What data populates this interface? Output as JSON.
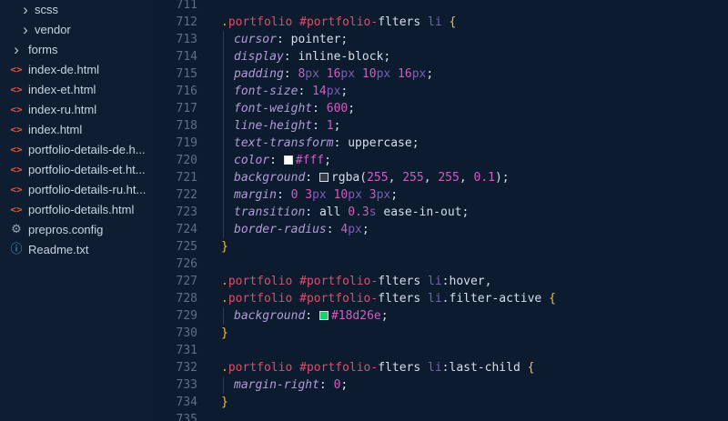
{
  "explorer": {
    "items": [
      {
        "type": "folder",
        "label": "scss",
        "depth": 1
      },
      {
        "type": "folder",
        "label": "vendor",
        "depth": 1
      },
      {
        "type": "folder",
        "label": "forms",
        "depth": 0
      },
      {
        "type": "html",
        "label": "index-de.html",
        "depth": 0
      },
      {
        "type": "html",
        "label": "index-et.html",
        "depth": 0
      },
      {
        "type": "html",
        "label": "index-ru.html",
        "depth": 0
      },
      {
        "type": "html",
        "label": "index.html",
        "depth": 0
      },
      {
        "type": "html",
        "label": "portfolio-details-de.h...",
        "depth": 0
      },
      {
        "type": "html",
        "label": "portfolio-details-et.ht...",
        "depth": 0
      },
      {
        "type": "html",
        "label": "portfolio-details-ru.ht...",
        "depth": 0
      },
      {
        "type": "html",
        "label": "portfolio-details.html",
        "depth": 0
      },
      {
        "type": "config",
        "label": "prepros.config",
        "depth": 0
      },
      {
        "type": "text",
        "label": "Readme.txt",
        "depth": 0
      }
    ],
    "icons": {
      "folder": "chevron-right-icon",
      "html": "html-tag-icon",
      "config": "gear-icon",
      "text": "info-icon"
    }
  },
  "editor": {
    "lines": [
      {
        "n": "711",
        "tokens": []
      },
      {
        "n": "712",
        "tokens": [
          [
            ".",
            "dot"
          ],
          [
            "portfolio",
            "sel"
          ],
          [
            " ",
            "val"
          ],
          [
            "#",
            "hash"
          ],
          [
            "portfolio-",
            "sel"
          ],
          [
            "flters",
            "val"
          ],
          [
            " ",
            "val"
          ],
          [
            "li",
            "tag"
          ],
          [
            " ",
            "val"
          ],
          [
            "{",
            "brace"
          ]
        ]
      },
      {
        "n": "713",
        "indent": true,
        "tokens": [
          [
            "cursor",
            "prop"
          ],
          [
            ": ",
            "colon"
          ],
          [
            "pointer",
            "val"
          ],
          [
            ";",
            "semi"
          ]
        ]
      },
      {
        "n": "714",
        "indent": true,
        "tokens": [
          [
            "display",
            "prop"
          ],
          [
            ": ",
            "colon"
          ],
          [
            "inline-block",
            "val"
          ],
          [
            ";",
            "semi"
          ]
        ]
      },
      {
        "n": "715",
        "indent": true,
        "tokens": [
          [
            "padding",
            "prop"
          ],
          [
            ": ",
            "colon"
          ],
          [
            "8",
            "num"
          ],
          [
            "px",
            "unit"
          ],
          [
            " ",
            "val"
          ],
          [
            "16",
            "num"
          ],
          [
            "px",
            "unit"
          ],
          [
            " ",
            "val"
          ],
          [
            "10",
            "num"
          ],
          [
            "px",
            "unit"
          ],
          [
            " ",
            "val"
          ],
          [
            "16",
            "num"
          ],
          [
            "px",
            "unit"
          ],
          [
            ";",
            "semi"
          ]
        ]
      },
      {
        "n": "716",
        "indent": true,
        "tokens": [
          [
            "font-size",
            "prop"
          ],
          [
            ": ",
            "colon"
          ],
          [
            "14",
            "num"
          ],
          [
            "px",
            "unit"
          ],
          [
            ";",
            "semi"
          ]
        ]
      },
      {
        "n": "717",
        "indent": true,
        "tokens": [
          [
            "font-weight",
            "prop"
          ],
          [
            ": ",
            "colon"
          ],
          [
            "600",
            "num"
          ],
          [
            ";",
            "semi"
          ]
        ]
      },
      {
        "n": "718",
        "indent": true,
        "tokens": [
          [
            "line-height",
            "prop"
          ],
          [
            ": ",
            "colon"
          ],
          [
            "1",
            "num"
          ],
          [
            ";",
            "semi"
          ]
        ]
      },
      {
        "n": "719",
        "indent": true,
        "tokens": [
          [
            "text-transform",
            "prop"
          ],
          [
            ": ",
            "colon"
          ],
          [
            "uppercase",
            "val"
          ],
          [
            ";",
            "semi"
          ]
        ]
      },
      {
        "n": "720",
        "indent": true,
        "tokens": [
          [
            "color",
            "prop"
          ],
          [
            ": ",
            "colon"
          ],
          [
            "#ffffff",
            "swatch"
          ],
          [
            "#fff",
            "num"
          ],
          [
            ";",
            "semi"
          ]
        ]
      },
      {
        "n": "721",
        "indent": true,
        "tokens": [
          [
            "background",
            "prop"
          ],
          [
            ": ",
            "colon"
          ],
          [
            "#3a3f47",
            "swatch"
          ],
          [
            "rgba(",
            "val"
          ],
          [
            "255",
            "num"
          ],
          [
            ", ",
            "val"
          ],
          [
            "255",
            "num"
          ],
          [
            ", ",
            "val"
          ],
          [
            "255",
            "num"
          ],
          [
            ", ",
            "val"
          ],
          [
            "0.1",
            "num"
          ],
          [
            ");",
            "val"
          ]
        ]
      },
      {
        "n": "722",
        "indent": true,
        "tokens": [
          [
            "margin",
            "prop"
          ],
          [
            ": ",
            "colon"
          ],
          [
            "0",
            "num"
          ],
          [
            " ",
            "val"
          ],
          [
            "3",
            "num"
          ],
          [
            "px",
            "unit"
          ],
          [
            " ",
            "val"
          ],
          [
            "10",
            "num"
          ],
          [
            "px",
            "unit"
          ],
          [
            " ",
            "val"
          ],
          [
            "3",
            "num"
          ],
          [
            "px",
            "unit"
          ],
          [
            ";",
            "semi"
          ]
        ]
      },
      {
        "n": "723",
        "indent": true,
        "tokens": [
          [
            "transition",
            "prop"
          ],
          [
            ": ",
            "colon"
          ],
          [
            "all ",
            "val"
          ],
          [
            "0.3",
            "num"
          ],
          [
            "s",
            "unit"
          ],
          [
            " ease-in-out",
            "val"
          ],
          [
            ";",
            "semi"
          ]
        ]
      },
      {
        "n": "724",
        "indent": true,
        "tokens": [
          [
            "border-radius",
            "prop"
          ],
          [
            ": ",
            "colon"
          ],
          [
            "4",
            "num"
          ],
          [
            "px",
            "unit"
          ],
          [
            ";",
            "semi"
          ]
        ]
      },
      {
        "n": "725",
        "tokens": [
          [
            "}",
            "brace"
          ]
        ]
      },
      {
        "n": "726",
        "tokens": []
      },
      {
        "n": "727",
        "tokens": [
          [
            ".",
            "dot"
          ],
          [
            "portfolio",
            "sel"
          ],
          [
            " ",
            "val"
          ],
          [
            "#",
            "hash"
          ],
          [
            "portfolio-",
            "sel"
          ],
          [
            "flters",
            "val"
          ],
          [
            " ",
            "val"
          ],
          [
            "li",
            "tag"
          ],
          [
            ":hover,",
            "pseudo"
          ]
        ]
      },
      {
        "n": "728",
        "tokens": [
          [
            ".",
            "dot"
          ],
          [
            "portfolio",
            "sel"
          ],
          [
            " ",
            "val"
          ],
          [
            "#",
            "hash"
          ],
          [
            "portfolio-",
            "sel"
          ],
          [
            "flters",
            "val"
          ],
          [
            " ",
            "val"
          ],
          [
            "li",
            "tag"
          ],
          [
            ".filter-active ",
            "pseudo"
          ],
          [
            "{",
            "brace"
          ]
        ]
      },
      {
        "n": "729",
        "indent": true,
        "tokens": [
          [
            "background",
            "prop"
          ],
          [
            ": ",
            "colon"
          ],
          [
            "#18d26e",
            "swatch"
          ],
          [
            "#18d26e",
            "num"
          ],
          [
            ";",
            "semi"
          ]
        ]
      },
      {
        "n": "730",
        "tokens": [
          [
            "}",
            "brace"
          ]
        ]
      },
      {
        "n": "731",
        "tokens": []
      },
      {
        "n": "732",
        "tokens": [
          [
            ".",
            "dot"
          ],
          [
            "portfolio",
            "sel"
          ],
          [
            " ",
            "val"
          ],
          [
            "#",
            "hash"
          ],
          [
            "portfolio-",
            "sel"
          ],
          [
            "flters",
            "val"
          ],
          [
            " ",
            "val"
          ],
          [
            "li",
            "tag"
          ],
          [
            ":last-child ",
            "pseudo"
          ],
          [
            "{",
            "brace"
          ]
        ]
      },
      {
        "n": "733",
        "indent": true,
        "tokens": [
          [
            "margin-right",
            "prop"
          ],
          [
            ": ",
            "colon"
          ],
          [
            "0",
            "num"
          ],
          [
            ";",
            "semi"
          ]
        ]
      },
      {
        "n": "734",
        "tokens": [
          [
            "}",
            "brace"
          ]
        ]
      },
      {
        "n": "735",
        "tokens": []
      }
    ]
  }
}
